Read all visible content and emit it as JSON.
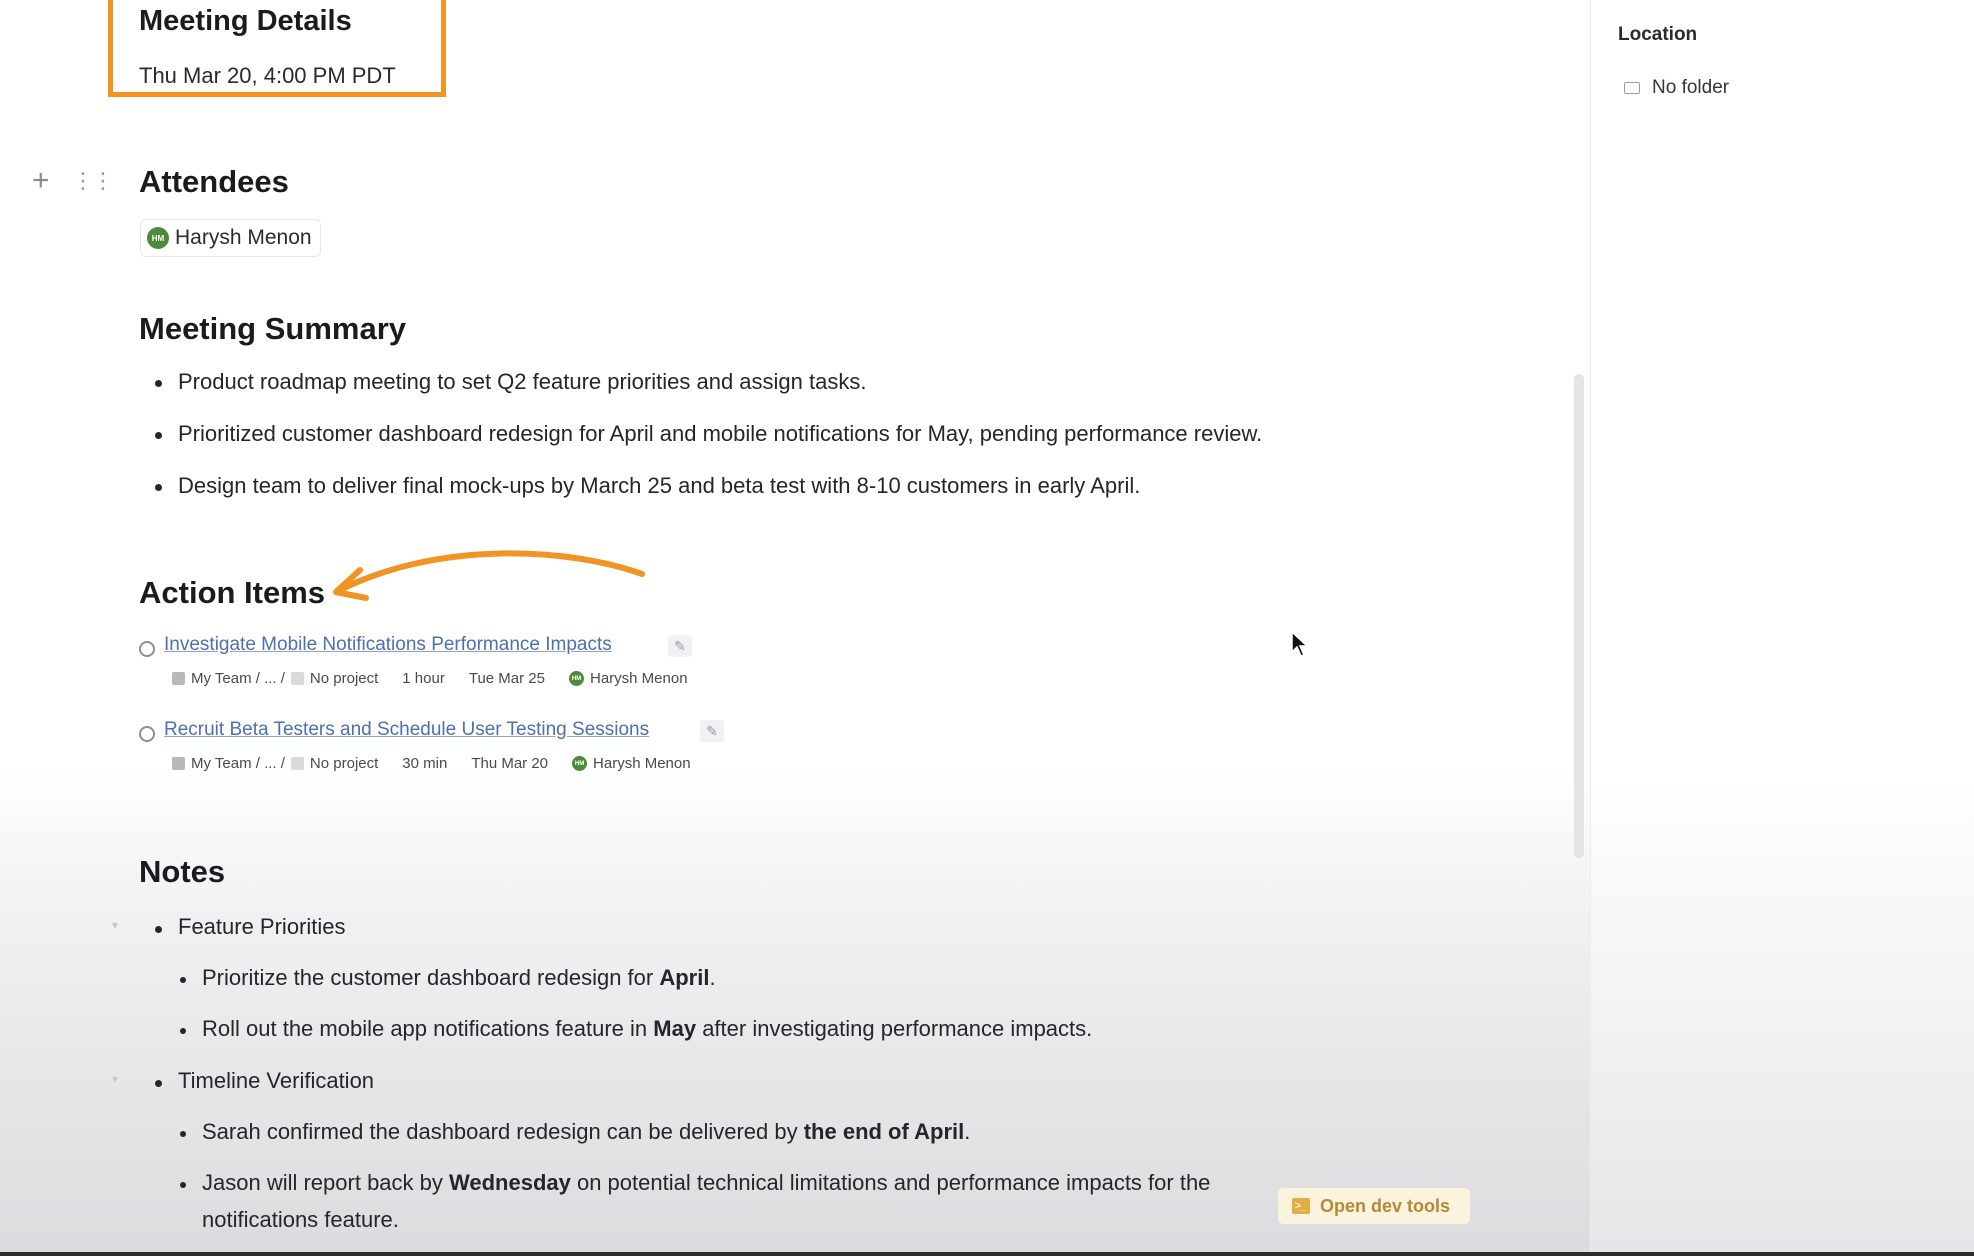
{
  "meeting": {
    "title": "Meeting Details",
    "datetime": "Thu Mar 20, 4:00 PM PDT"
  },
  "attendees": {
    "heading": "Attendees",
    "people": [
      {
        "initials": "HM",
        "name": "Harysh Menon"
      }
    ]
  },
  "summary": {
    "heading": "Meeting Summary",
    "items": [
      "Product roadmap meeting to set Q2 feature priorities and assign tasks.",
      "Prioritized customer dashboard redesign for April and mobile notifications for May, pending performance review.",
      "Design team to deliver final mock-ups by March 25 and beta test with 8-10 customers in early April."
    ]
  },
  "action_items": {
    "heading": "Action Items",
    "tasks": [
      {
        "title": "Investigate Mobile Notifications Performance Impacts",
        "team": "My Team / ... /",
        "project": "No project",
        "duration": "1 hour",
        "due": "Tue Mar 25",
        "assignee_initials": "HM",
        "assignee": "Harysh Menon"
      },
      {
        "title": "Recruit Beta Testers and Schedule User Testing Sessions",
        "team": "My Team / ... /",
        "project": "No project",
        "duration": "30 min",
        "due": "Thu Mar 20",
        "assignee_initials": "HM",
        "assignee": "Harysh Menon"
      }
    ]
  },
  "notes": {
    "heading": "Notes",
    "groups": [
      {
        "label": "Feature Priorities",
        "items": [
          {
            "before": "Prioritize the customer dashboard redesign for ",
            "bold": "April",
            "after": "."
          },
          {
            "before": "Roll out the mobile app notifications feature in ",
            "bold": "May",
            "after": " after investigating performance impacts."
          }
        ]
      },
      {
        "label": "Timeline Verification",
        "items": [
          {
            "before": "Sarah confirmed the dashboard redesign can be delivered by ",
            "bold": "the end of April",
            "after": "."
          },
          {
            "before": "Jason will report back by ",
            "bold": "Wednesday",
            "after": " on potential technical limitations and performance impacts for the",
            "line2": "notifications feature."
          }
        ]
      }
    ]
  },
  "sidebar": {
    "location_label": "Location",
    "folder": "No folder"
  },
  "devtools": {
    "label": "Open dev tools"
  },
  "colors": {
    "annotation": "#f39323",
    "link": "#4e6fb2",
    "avatar": "#4e8a3c",
    "devtools_bg": "#fbf3dd",
    "devtools_text": "#b58a36"
  },
  "icons": [
    "plus-icon",
    "drag-handle-icon",
    "avatar",
    "edit-icon",
    "cube-icon",
    "folder-icon",
    "terminal-icon",
    "cursor-icon",
    "annotation-arrow"
  ]
}
